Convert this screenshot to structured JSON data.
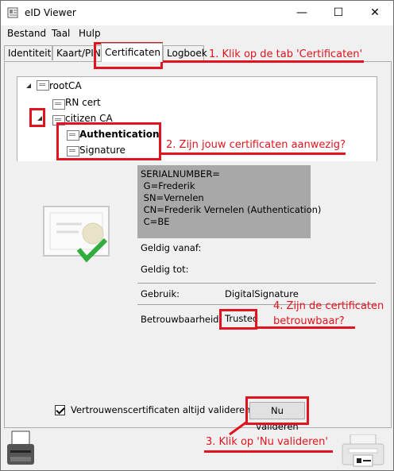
{
  "window": {
    "title": "eID Viewer",
    "minimize": "—",
    "maximize": "☐",
    "close": "✕"
  },
  "menu": [
    "Bestand",
    "Taal",
    "Hulp"
  ],
  "tabs": [
    "Identiteit",
    "Kaart/PIN",
    "Certificaten",
    "Logboek"
  ],
  "active_tab": "Certificaten",
  "tree": {
    "root": "rootCA",
    "rn_cert": "RN cert",
    "citizen": "citizen CA",
    "authentication": "Authentication",
    "signature": "Signature"
  },
  "details": {
    "subject_lines": [
      "SERIALNUMBER=",
      " G=Frederik",
      " SN=Vernelen",
      " CN=Frederik Vernelen (Authentication)",
      " C=BE"
    ],
    "valid_from_label": "Geldig vanaf:",
    "valid_to_label": "Geldig tot:",
    "usage_label": "Gebruik:",
    "usage_value": "DigitalSignature",
    "trust_label": "Betrouwbaarheid:",
    "trust_value": "Trusted"
  },
  "footer": {
    "checkbox_label": "Vertrouwenscertificaten altijd valideren",
    "checkbox_checked": true,
    "validate_button": "Nu valideren"
  },
  "annotations": {
    "step1": "1. Klik op de tab 'Certificaten'",
    "step2": "2. Zijn jouw certificaten aanwezig?",
    "step3": "3. Klik op 'Nu valideren'",
    "step4_line1": "4. Zijn de certificaten",
    "step4_line2": "betrouwbaar?",
    "color": "#e0141e"
  }
}
